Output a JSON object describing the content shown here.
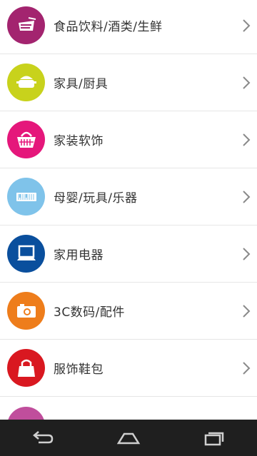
{
  "categories": [
    {
      "label": "食品饮料/酒类/生鲜",
      "icon": "food-drink-icon",
      "color": "#a3246f"
    },
    {
      "label": "家具/厨具",
      "icon": "kitchen-pot-icon",
      "color": "#c8d21c"
    },
    {
      "label": "家装软饰",
      "icon": "basket-icon",
      "color": "#e5177b"
    },
    {
      "label": "母婴/玩具/乐器",
      "icon": "keyboard-toy-icon",
      "color": "#7fc3ea"
    },
    {
      "label": "家用电器",
      "icon": "computer-monitor-icon",
      "color": "#0a4f9d"
    },
    {
      "label": "3C数码/配件",
      "icon": "camera-icon",
      "color": "#ee7d1b"
    },
    {
      "label": "服饰鞋包",
      "icon": "handbag-icon",
      "color": "#d91820"
    },
    {
      "label": "",
      "icon": "partial-category-icon",
      "color": "#c04e9c"
    }
  ],
  "navbar": {
    "back": "back-icon",
    "home": "home-icon",
    "recents": "recent-apps-icon"
  }
}
